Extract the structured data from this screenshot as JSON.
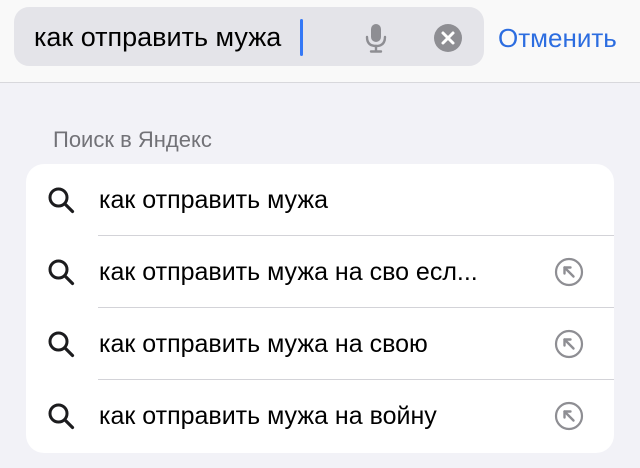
{
  "search": {
    "query": "как отправить мужа",
    "cancel_label": "Отменить"
  },
  "section": {
    "title": "Поиск в Яндекс"
  },
  "suggestions": [
    {
      "text": "как отправить мужа",
      "has_fill_arrow": false
    },
    {
      "text": "как отправить мужа на сво есл...",
      "has_fill_arrow": true
    },
    {
      "text": "как отправить мужа на свою",
      "has_fill_arrow": true
    },
    {
      "text": "как отправить мужа на войну",
      "has_fill_arrow": true
    }
  ],
  "colors": {
    "accent": "#2c6de0",
    "caret": "#3478f6",
    "field_bg": "#e4e4e9",
    "page_bg": "#f2f2f7",
    "icon_gray": "#8e8e93"
  },
  "icons": {
    "mic": "microphone-icon",
    "clear": "clear-circle-icon",
    "search": "magnifier-icon",
    "fill": "arrow-up-left-circle-icon"
  }
}
